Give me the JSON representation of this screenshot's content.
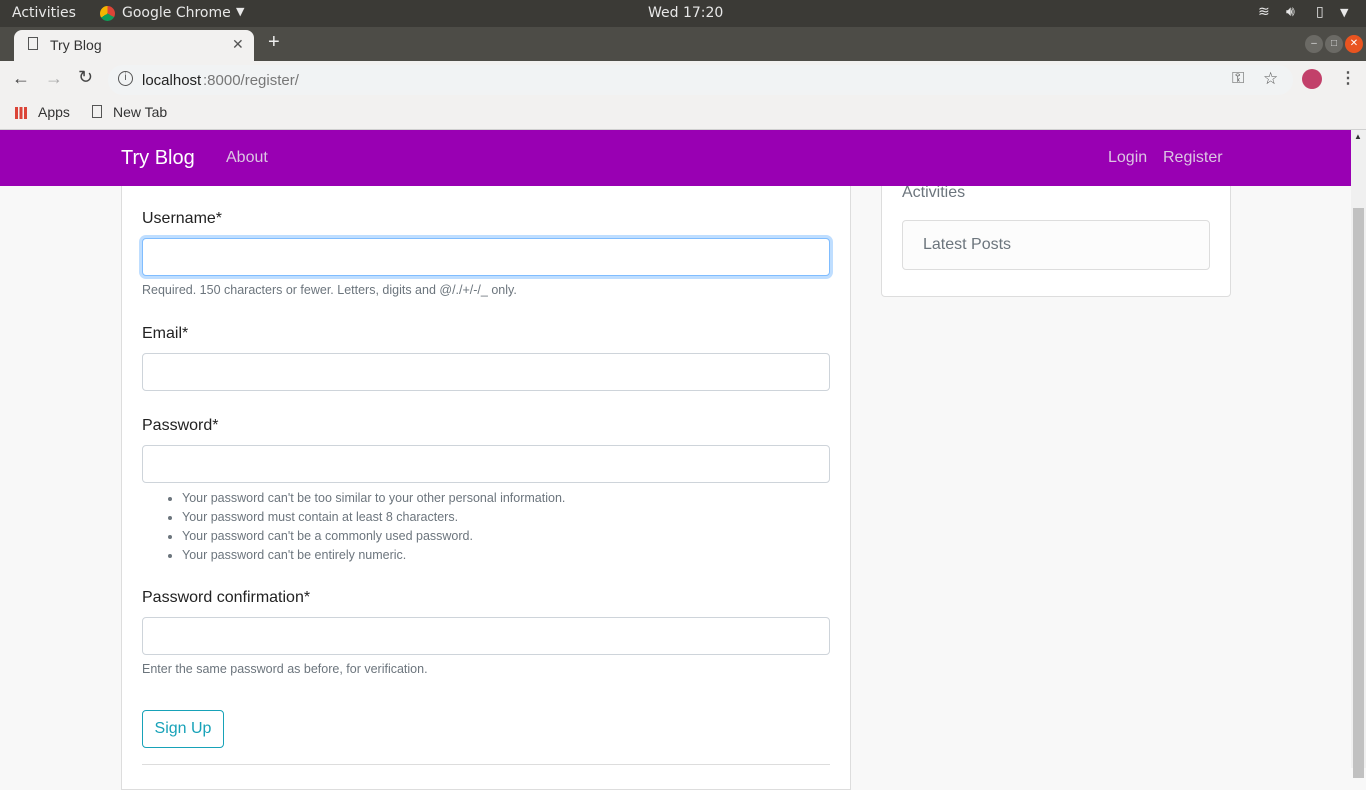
{
  "os": {
    "activities": "Activities",
    "app": "Google Chrome",
    "clock": "Wed 17:20"
  },
  "browser": {
    "tab_title": "Try Blog",
    "url_host": "localhost",
    "url_path": ":8000/register/",
    "bookmarks": [
      "Apps",
      "New Tab"
    ]
  },
  "nav": {
    "brand": "Try Blog",
    "about": "About",
    "login": "Login",
    "register": "Register"
  },
  "form": {
    "username_label": "Username*",
    "username_help": "Required. 150 characters or fewer. Letters, digits and @/./+/-/_ only.",
    "email_label": "Email*",
    "password_label": "Password*",
    "password_rules": [
      "Your password can't be too similar to your other personal information.",
      "Your password must contain at least 8 characters.",
      "Your password can't be a commonly used password.",
      "Your password can't be entirely numeric."
    ],
    "confirm_label": "Password confirmation*",
    "confirm_help": "Enter the same password as before, for verification.",
    "submit": "Sign Up"
  },
  "sidebar": {
    "heading": "Activities",
    "item": "Latest Posts"
  },
  "colors": {
    "navbar": "#9900b3",
    "button": "#17a2b8"
  }
}
